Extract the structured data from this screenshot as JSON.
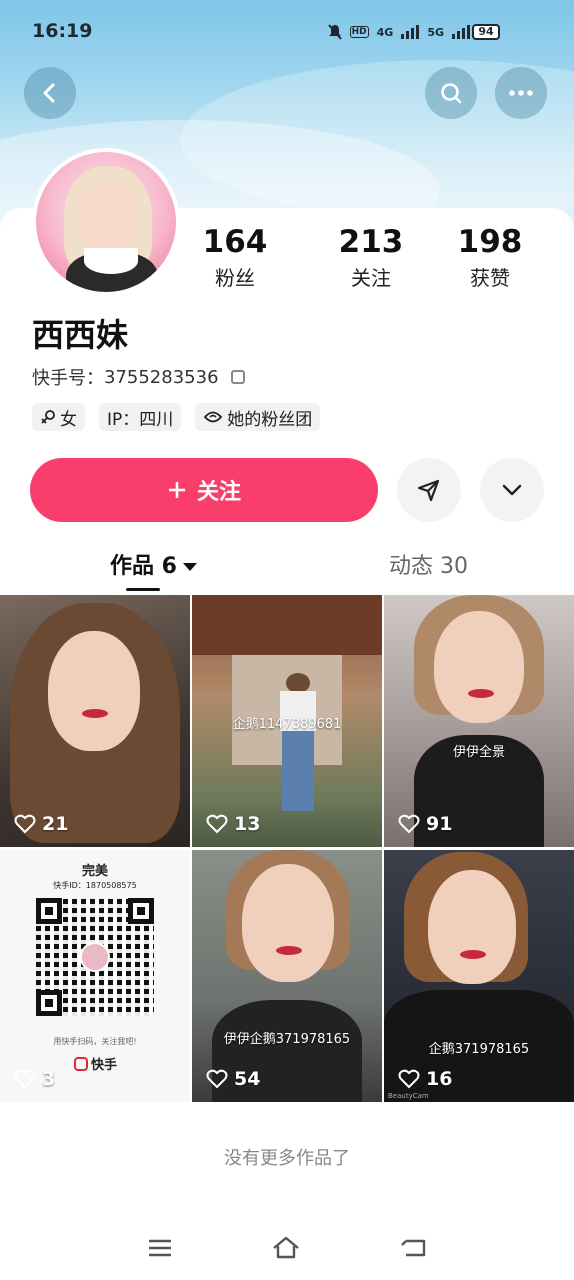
{
  "status_bar": {
    "time": "16:19",
    "network_hd": "HD",
    "network_4g": "4G",
    "network_5g": "5G",
    "battery": "94"
  },
  "header": {
    "back_icon": "chevron-left-icon",
    "search_icon": "search-icon",
    "more_icon": "more-dots-icon"
  },
  "profile": {
    "stats": [
      {
        "value": "164",
        "label": "粉丝"
      },
      {
        "value": "213",
        "label": "关注"
      },
      {
        "value": "198",
        "label": "获赞"
      }
    ],
    "name": "西西妹",
    "uid_label": "快手号：",
    "uid": "3755283536",
    "tags": {
      "gender": "女",
      "ip": "IP：四川",
      "fan_group": "她的粉丝团"
    },
    "follow_label": "关注"
  },
  "tabs": {
    "works": "作品 6",
    "moments": "动态 30"
  },
  "posts": [
    {
      "likes": "21",
      "overlay": ""
    },
    {
      "likes": "13",
      "overlay": "企鹅1147389681"
    },
    {
      "likes": "91",
      "overlay": "伊伊全景"
    },
    {
      "likes": "3",
      "overlay": "完美",
      "qr_id": "快手ID：1870508575",
      "qr_caption": "用快手扫码，关注我吧!",
      "brand": "快手"
    },
    {
      "likes": "54",
      "overlay": "伊伊企鹅371978165"
    },
    {
      "likes": "16",
      "overlay": "企鹅371978165",
      "watermark": "BeautyCam"
    }
  ],
  "footer": {
    "no_more": "没有更多作品了"
  },
  "colors": {
    "accent": "#fa3e6b",
    "banner": "#7fc6e8"
  }
}
